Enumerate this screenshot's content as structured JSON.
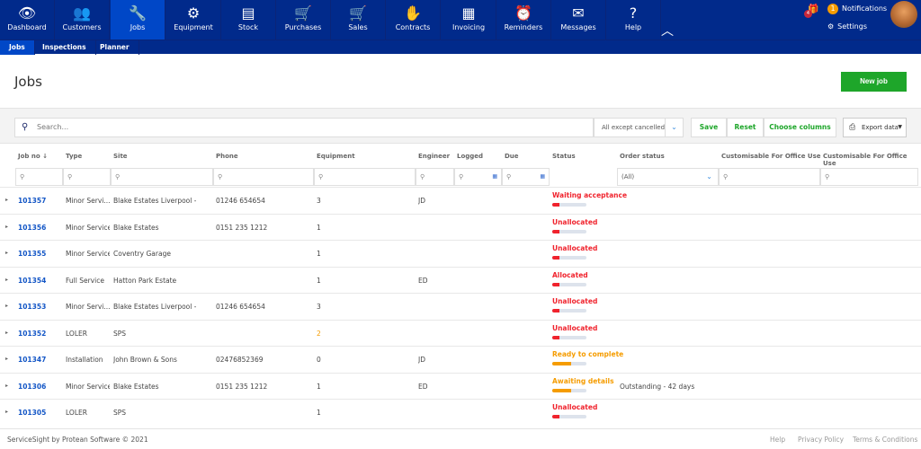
{
  "nav": [
    {
      "label": "Dashboard",
      "icon": "eye-icon",
      "glyph": "👁"
    },
    {
      "label": "Customers",
      "icon": "users-icon",
      "glyph": "👥"
    },
    {
      "label": "Jobs",
      "icon": "wrench-icon",
      "glyph": "🔧",
      "active": true
    },
    {
      "label": "Equipment",
      "icon": "cogs-icon",
      "glyph": "⚙"
    },
    {
      "label": "Stock",
      "icon": "stock-icon",
      "glyph": "▤"
    },
    {
      "label": "Purchases",
      "icon": "cart-down-icon",
      "glyph": "🛒"
    },
    {
      "label": "Sales",
      "icon": "cart-up-icon",
      "glyph": "🛒"
    },
    {
      "label": "Contracts",
      "icon": "handshake-icon",
      "glyph": "✋"
    },
    {
      "label": "Invoicing",
      "icon": "invoice-icon",
      "glyph": "▦"
    },
    {
      "label": "Reminders",
      "icon": "alarm-clock-icon",
      "glyph": "⏰"
    },
    {
      "label": "Messages",
      "icon": "envelope-icon",
      "glyph": "✉"
    },
    {
      "label": "Help",
      "icon": "question-icon",
      "glyph": "?"
    }
  ],
  "collapse_glyph": "︿",
  "user": {
    "gift_badge": "4",
    "notif_count": "1",
    "notifications": "Notifications",
    "settings": "Settings"
  },
  "subnav": [
    "Jobs",
    "Inspections",
    "Planner"
  ],
  "page": {
    "title": "Jobs",
    "new_job": "New job"
  },
  "toolbar": {
    "search_placeholder": "Search...",
    "filter": "All except cancelled",
    "save": "Save",
    "reset": "Reset",
    "choose_columns": "Choose columns",
    "export": "Export data"
  },
  "columns": [
    "Job no ↓",
    "Type",
    "Site",
    "Phone",
    "Equipment",
    "Engineer",
    "Logged",
    "Due",
    "Status",
    "Order status",
    "Customisable For Office Use",
    "Customisable For Office Use"
  ],
  "order_status_filter": "(All)",
  "colors": {
    "red": "#f0232d",
    "orange": "#f59c00",
    "green": "#1ea62a",
    "nav": "#012a8b"
  },
  "rows": [
    {
      "job": "101357",
      "type": "Minor Servi...",
      "site": "Blake Estates Liverpool -",
      "phone": "01246 654654",
      "equipment": "3",
      "engineer": "JD",
      "status": "Waiting acceptance",
      "color": "red",
      "progress": 0.2,
      "order": ""
    },
    {
      "job": "101356",
      "type": "Minor Service",
      "site": "Blake Estates",
      "phone": "0151 235 1212",
      "equipment": "1",
      "engineer": "",
      "status": "Unallocated",
      "color": "red",
      "progress": 0.2,
      "order": ""
    },
    {
      "job": "101355",
      "type": "Minor Service",
      "site": "Coventry Garage",
      "phone": "",
      "equipment": "1",
      "engineer": "",
      "status": "Unallocated",
      "color": "red",
      "progress": 0.2,
      "order": ""
    },
    {
      "job": "101354",
      "type": "Full Service",
      "site": "Hatton Park Estate",
      "phone": "",
      "equipment": "1",
      "engineer": "ED",
      "status": "Allocated",
      "color": "red",
      "progress": 0.2,
      "order": ""
    },
    {
      "job": "101353",
      "type": "Minor Servi...",
      "site": "Blake Estates Liverpool -",
      "phone": "01246 654654",
      "equipment": "3",
      "engineer": "",
      "status": "Unallocated",
      "color": "red",
      "progress": 0.2,
      "order": ""
    },
    {
      "job": "101352",
      "type": "LOLER",
      "site": "SPS",
      "phone": "",
      "equipment": "2",
      "equipment_color": "orange",
      "engineer": "",
      "status": "Unallocated",
      "color": "red",
      "progress": 0.2,
      "order": ""
    },
    {
      "job": "101347",
      "type": "Installation",
      "site": "John Brown & Sons",
      "phone": "02476852369",
      "equipment": "0",
      "engineer": "JD",
      "status": "Ready to complete",
      "color": "orange",
      "progress": 0.55,
      "order": ""
    },
    {
      "job": "101306",
      "type": "Minor Service",
      "site": "Blake Estates",
      "phone": "0151 235 1212",
      "equipment": "1",
      "engineer": "ED",
      "status": "Awaiting details",
      "color": "orange",
      "progress": 0.55,
      "order": "Outstanding - 42 days"
    },
    {
      "job": "101305",
      "type": "LOLER",
      "site": "SPS",
      "phone": "",
      "equipment": "1",
      "engineer": "",
      "status": "Unallocated",
      "color": "red",
      "progress": 0.2,
      "order": ""
    }
  ],
  "footer": {
    "copyright": "ServiceSight by Protean Software © 2021",
    "links": [
      "Help",
      "Privacy Policy",
      "Terms & Conditions"
    ]
  }
}
